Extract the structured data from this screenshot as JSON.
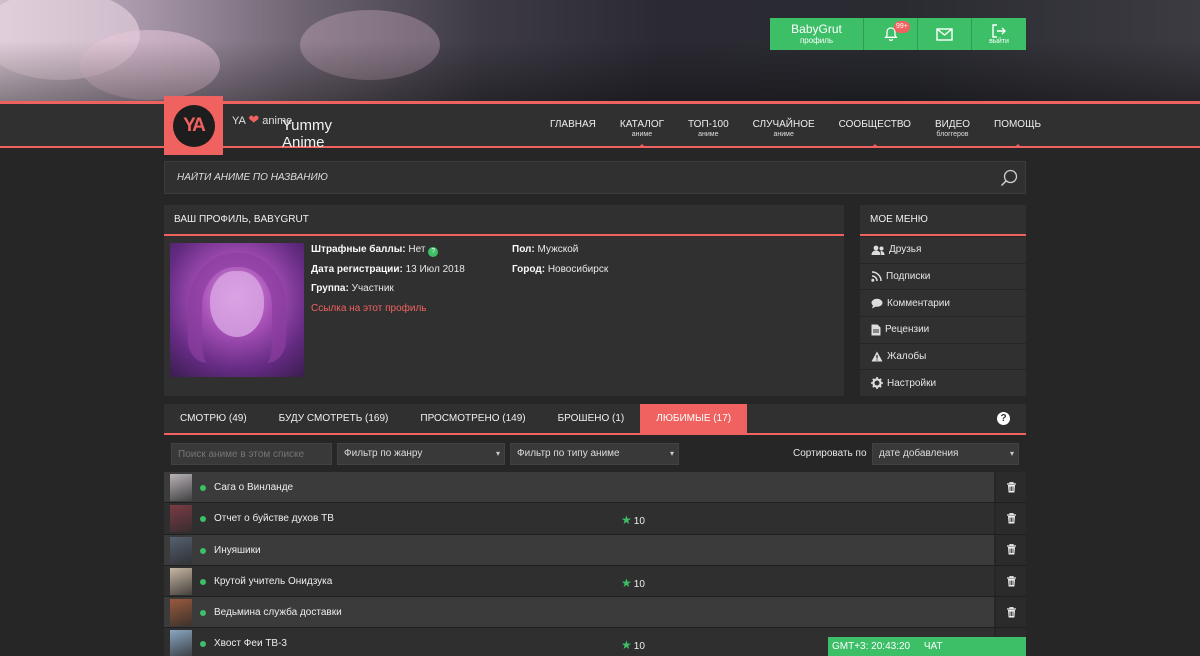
{
  "user": {
    "name": "BabyGrut",
    "profile_label": "профиль",
    "notifications_badge": "99+",
    "logout_label": "выйти"
  },
  "brand": {
    "logo_text": "YA",
    "title": "Yummy Anime",
    "tag_prefix": "YA",
    "tag_suffix": "anime"
  },
  "nav": [
    {
      "label": "ГЛАВНАЯ",
      "sub": "",
      "arrow": false
    },
    {
      "label": "КАТАЛОГ",
      "sub": "аниме",
      "arrow": true
    },
    {
      "label": "ТОП-100",
      "sub": "аниме",
      "arrow": false
    },
    {
      "label": "СЛУЧАЙНОЕ",
      "sub": "аниме",
      "arrow": false
    },
    {
      "label": "СООБЩЕСТВО",
      "sub": "",
      "arrow": true
    },
    {
      "label": "ВИДЕО",
      "sub": "блоггеров",
      "arrow": false
    },
    {
      "label": "ПОМОЩЬ",
      "sub": "",
      "arrow": true
    }
  ],
  "search": {
    "placeholder": "НАЙТИ АНИМЕ ПО НАЗВАНИЮ"
  },
  "profile": {
    "heading": "ВАШ ПРОФИЛЬ, BABYGRUT",
    "penalty_label": "Штрафные баллы:",
    "penalty_value": "Нет",
    "reg_label": "Дата регистрации:",
    "reg_value": "13 Июл 2018",
    "group_label": "Группа:",
    "group_value": "Участник",
    "link": "Ссылка на этот профиль",
    "sex_label": "Пол:",
    "sex_value": "Мужской",
    "city_label": "Город:",
    "city_value": "Новосибирск"
  },
  "menu": {
    "heading": "МОЕ МЕНЮ",
    "items": [
      {
        "label": "Друзья",
        "icon": "friends-icon"
      },
      {
        "label": "Подписки",
        "icon": "rss-icon"
      },
      {
        "label": "Комментарии",
        "icon": "comment-icon"
      },
      {
        "label": "Рецензии",
        "icon": "document-icon"
      },
      {
        "label": "Жалобы",
        "icon": "warning-icon"
      },
      {
        "label": "Настройки",
        "icon": "gear-icon"
      }
    ]
  },
  "tabs": [
    {
      "label": "СМОТРЮ (49)",
      "active": false
    },
    {
      "label": "БУДУ СМОТРЕТЬ (169)",
      "active": false
    },
    {
      "label": "ПРОСМОТРЕНО (149)",
      "active": false
    },
    {
      "label": "БРОШЕНО (1)",
      "active": false
    },
    {
      "label": "ЛЮБИМЫЕ (17)",
      "active": true
    }
  ],
  "help_symbol": "?",
  "filters": {
    "search_placeholder": "Поиск аниме в этом списке",
    "genre": "Фильтр по жанру",
    "type": "Фильтр по типу аниме",
    "sort_label": "Сортировать по",
    "sort_value": "дате добавления"
  },
  "anime": [
    {
      "title": "Сага о Винланде",
      "rating": "",
      "thumb": "#b9b3b8"
    },
    {
      "title": "Отчет о буйстве духов ТВ",
      "rating": "10",
      "thumb": "#7b3b44"
    },
    {
      "title": "Инуяшики",
      "rating": "",
      "thumb": "#556070"
    },
    {
      "title": "Крутой учитель Онидзука",
      "rating": "10",
      "thumb": "#c7b7a3"
    },
    {
      "title": "Ведьмина служба доставки",
      "rating": "",
      "thumb": "#9a5a3c"
    },
    {
      "title": "Хвост Феи ТВ-3",
      "rating": "10",
      "thumb": "#8aa6c2"
    }
  ],
  "chat": {
    "time": "GMT+3: 20:43:20",
    "label": "ЧАТ"
  },
  "colors": {
    "accent": "#f0625f",
    "green": "#3cbf67",
    "bg": "#262626",
    "panel": "#303030"
  }
}
